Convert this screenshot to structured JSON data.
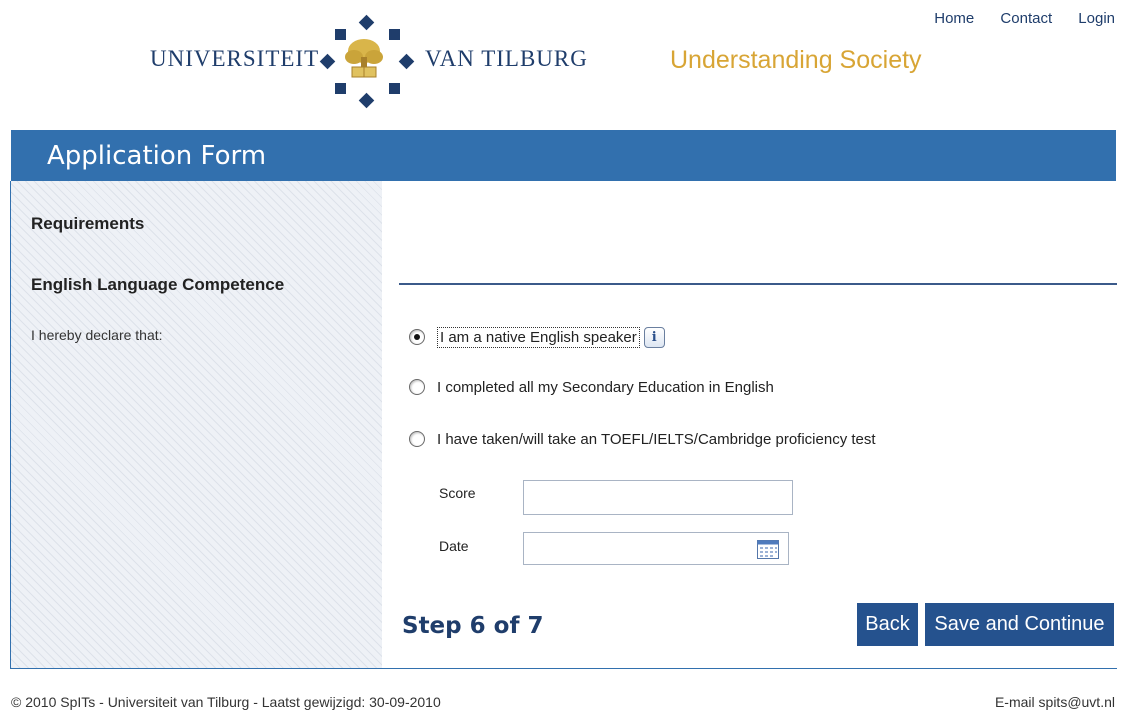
{
  "header": {
    "logo_left": "UNIVERSITEIT",
    "logo_right": "VAN TILBURG",
    "tagline": "Understanding Society",
    "nav": [
      "Home",
      "Contact",
      "Login"
    ]
  },
  "form": {
    "title": "Application Form",
    "sidebar": {
      "requirements": "Requirements",
      "section": "English Language Competence",
      "declare": "I hereby declare that:"
    },
    "options": [
      {
        "label": "I am a native English speaker",
        "selected": true
      },
      {
        "label": "I completed all my Secondary Education in English",
        "selected": false
      },
      {
        "label": "I have taken/will take an TOEFL/IELTS/Cambridge proficiency test",
        "selected": false
      }
    ],
    "info_icon": "i",
    "fields": {
      "score_label": "Score",
      "score_value": "",
      "date_label": "Date",
      "date_value": ""
    },
    "step": "Step 6 of 7",
    "buttons": {
      "back": "Back",
      "save": "Save and Continue"
    }
  },
  "footer": {
    "left": "© 2010 SpITs - Universiteit van Tilburg - Laatst gewijzigd: 30-09-2010",
    "right": "E-mail spits@uvt.nl"
  },
  "colors": {
    "brand_blue": "#3270ae",
    "button_blue": "#25528e",
    "gold": "#d8a535"
  },
  "icons": [
    "university-logo-icon",
    "info-icon",
    "calendar-icon"
  ]
}
